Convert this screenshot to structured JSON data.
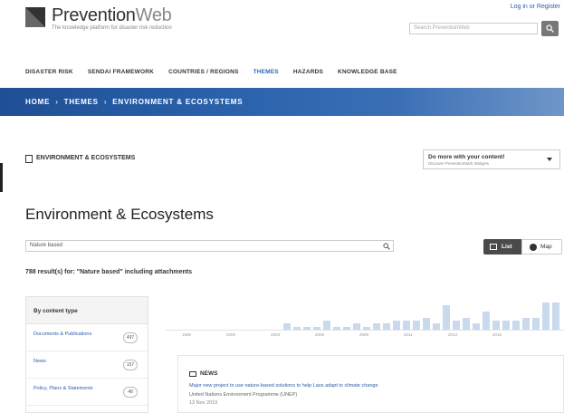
{
  "header": {
    "logo_primary": "Prevention",
    "logo_secondary": "Web",
    "tagline": "The knowledge platform for disaster risk reduction",
    "login_link": "Log in or Register",
    "search_placeholder": "Search PreventionWeb"
  },
  "nav": {
    "items": [
      {
        "label": "DISASTER RISK",
        "active": false
      },
      {
        "label": "SENDAI FRAMEWORK",
        "active": false
      },
      {
        "label": "COUNTRIES / REGIONS",
        "active": false
      },
      {
        "label": "THEMES",
        "active": true
      },
      {
        "label": "HAZARDS",
        "active": false
      },
      {
        "label": "KNOWLEDGE BASE",
        "active": false
      }
    ]
  },
  "breadcrumb": {
    "items": [
      "HOME",
      "THEMES",
      "ENVIRONMENT & ECOSYSTEMS"
    ],
    "separator": "›"
  },
  "section": {
    "label": "ENVIRONMENT & ECOSYSTEMS",
    "do_more_title": "Do more with your content!",
    "do_more_subtitle": "Discover PreventionWeb Widgets"
  },
  "page": {
    "title": "Environment & Ecosystems"
  },
  "filter": {
    "value": "Nature based",
    "list_label": "List",
    "map_label": "Map",
    "results_text": "788 result(s) for: \"Nature based\" including attachments"
  },
  "facets": {
    "heading": "By content type",
    "items": [
      {
        "label": "Documents & Publications",
        "count": "497"
      },
      {
        "label": "News",
        "count": "157"
      },
      {
        "label": "Policy, Plans & Statements",
        "count": "48"
      }
    ]
  },
  "histogram": {
    "year_labels": [
      "1995",
      "2000",
      "2003",
      "2006",
      "2009",
      "2011",
      "2013",
      "2015"
    ],
    "values": [
      2,
      1,
      1,
      1,
      3,
      1,
      1,
      2,
      1,
      2,
      2,
      3,
      3,
      3,
      4,
      2,
      8,
      3,
      4,
      2,
      6,
      3,
      3,
      3,
      4,
      4,
      9,
      9
    ]
  },
  "news": {
    "tag": "NEWS",
    "title": "Major new project to use nature-based solutions to help Laos adapt to climate change",
    "org": "United Nations Environment Programme (UNEP)",
    "date": "13 Nov 2019"
  },
  "colors": {
    "accent": "#2a66b4",
    "banner": "#1f4f95",
    "link": "#2a5ea8",
    "histogram_bar": "#c9d9ee"
  }
}
